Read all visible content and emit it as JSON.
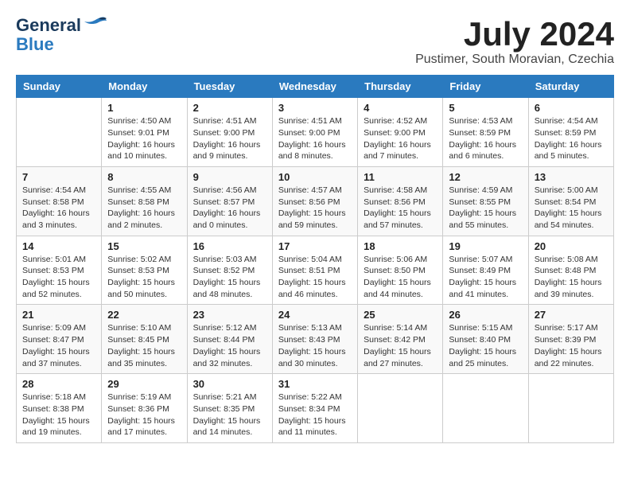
{
  "logo": {
    "line1": "General",
    "line2": "Blue"
  },
  "title": "July 2024",
  "location": "Pustimer, South Moravian, Czechia",
  "days_of_week": [
    "Sunday",
    "Monday",
    "Tuesday",
    "Wednesday",
    "Thursday",
    "Friday",
    "Saturday"
  ],
  "weeks": [
    [
      {
        "day": "",
        "info": ""
      },
      {
        "day": "1",
        "info": "Sunrise: 4:50 AM\nSunset: 9:01 PM\nDaylight: 16 hours\nand 10 minutes."
      },
      {
        "day": "2",
        "info": "Sunrise: 4:51 AM\nSunset: 9:00 PM\nDaylight: 16 hours\nand 9 minutes."
      },
      {
        "day": "3",
        "info": "Sunrise: 4:51 AM\nSunset: 9:00 PM\nDaylight: 16 hours\nand 8 minutes."
      },
      {
        "day": "4",
        "info": "Sunrise: 4:52 AM\nSunset: 9:00 PM\nDaylight: 16 hours\nand 7 minutes."
      },
      {
        "day": "5",
        "info": "Sunrise: 4:53 AM\nSunset: 8:59 PM\nDaylight: 16 hours\nand 6 minutes."
      },
      {
        "day": "6",
        "info": "Sunrise: 4:54 AM\nSunset: 8:59 PM\nDaylight: 16 hours\nand 5 minutes."
      }
    ],
    [
      {
        "day": "7",
        "info": "Sunrise: 4:54 AM\nSunset: 8:58 PM\nDaylight: 16 hours\nand 3 minutes."
      },
      {
        "day": "8",
        "info": "Sunrise: 4:55 AM\nSunset: 8:58 PM\nDaylight: 16 hours\nand 2 minutes."
      },
      {
        "day": "9",
        "info": "Sunrise: 4:56 AM\nSunset: 8:57 PM\nDaylight: 16 hours\nand 0 minutes."
      },
      {
        "day": "10",
        "info": "Sunrise: 4:57 AM\nSunset: 8:56 PM\nDaylight: 15 hours\nand 59 minutes."
      },
      {
        "day": "11",
        "info": "Sunrise: 4:58 AM\nSunset: 8:56 PM\nDaylight: 15 hours\nand 57 minutes."
      },
      {
        "day": "12",
        "info": "Sunrise: 4:59 AM\nSunset: 8:55 PM\nDaylight: 15 hours\nand 55 minutes."
      },
      {
        "day": "13",
        "info": "Sunrise: 5:00 AM\nSunset: 8:54 PM\nDaylight: 15 hours\nand 54 minutes."
      }
    ],
    [
      {
        "day": "14",
        "info": "Sunrise: 5:01 AM\nSunset: 8:53 PM\nDaylight: 15 hours\nand 52 minutes."
      },
      {
        "day": "15",
        "info": "Sunrise: 5:02 AM\nSunset: 8:53 PM\nDaylight: 15 hours\nand 50 minutes."
      },
      {
        "day": "16",
        "info": "Sunrise: 5:03 AM\nSunset: 8:52 PM\nDaylight: 15 hours\nand 48 minutes."
      },
      {
        "day": "17",
        "info": "Sunrise: 5:04 AM\nSunset: 8:51 PM\nDaylight: 15 hours\nand 46 minutes."
      },
      {
        "day": "18",
        "info": "Sunrise: 5:06 AM\nSunset: 8:50 PM\nDaylight: 15 hours\nand 44 minutes."
      },
      {
        "day": "19",
        "info": "Sunrise: 5:07 AM\nSunset: 8:49 PM\nDaylight: 15 hours\nand 41 minutes."
      },
      {
        "day": "20",
        "info": "Sunrise: 5:08 AM\nSunset: 8:48 PM\nDaylight: 15 hours\nand 39 minutes."
      }
    ],
    [
      {
        "day": "21",
        "info": "Sunrise: 5:09 AM\nSunset: 8:47 PM\nDaylight: 15 hours\nand 37 minutes."
      },
      {
        "day": "22",
        "info": "Sunrise: 5:10 AM\nSunset: 8:45 PM\nDaylight: 15 hours\nand 35 minutes."
      },
      {
        "day": "23",
        "info": "Sunrise: 5:12 AM\nSunset: 8:44 PM\nDaylight: 15 hours\nand 32 minutes."
      },
      {
        "day": "24",
        "info": "Sunrise: 5:13 AM\nSunset: 8:43 PM\nDaylight: 15 hours\nand 30 minutes."
      },
      {
        "day": "25",
        "info": "Sunrise: 5:14 AM\nSunset: 8:42 PM\nDaylight: 15 hours\nand 27 minutes."
      },
      {
        "day": "26",
        "info": "Sunrise: 5:15 AM\nSunset: 8:40 PM\nDaylight: 15 hours\nand 25 minutes."
      },
      {
        "day": "27",
        "info": "Sunrise: 5:17 AM\nSunset: 8:39 PM\nDaylight: 15 hours\nand 22 minutes."
      }
    ],
    [
      {
        "day": "28",
        "info": "Sunrise: 5:18 AM\nSunset: 8:38 PM\nDaylight: 15 hours\nand 19 minutes."
      },
      {
        "day": "29",
        "info": "Sunrise: 5:19 AM\nSunset: 8:36 PM\nDaylight: 15 hours\nand 17 minutes."
      },
      {
        "day": "30",
        "info": "Sunrise: 5:21 AM\nSunset: 8:35 PM\nDaylight: 15 hours\nand 14 minutes."
      },
      {
        "day": "31",
        "info": "Sunrise: 5:22 AM\nSunset: 8:34 PM\nDaylight: 15 hours\nand 11 minutes."
      },
      {
        "day": "",
        "info": ""
      },
      {
        "day": "",
        "info": ""
      },
      {
        "day": "",
        "info": ""
      }
    ]
  ]
}
